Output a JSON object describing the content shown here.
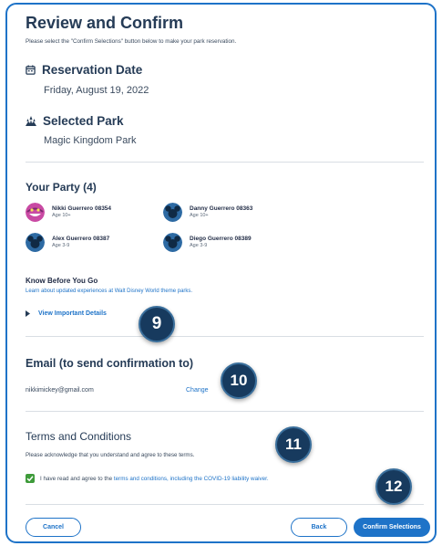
{
  "header": {
    "title": "Review and Confirm",
    "subtitle": "Please select the \"Confirm Selections\" button below to make your park reservation."
  },
  "reservation": {
    "date_label": "Reservation Date",
    "date_value": "Friday, August 19, 2022",
    "date_icon": "calendar-icon",
    "park_label": "Selected Park",
    "park_value": "Magic Kingdom Park",
    "park_icon": "castle-icon"
  },
  "party": {
    "title": "Your Party (4)",
    "members": [
      {
        "name": "Nikki Guerrero 08354",
        "age": "Age 10+",
        "avatar": "cheshire-cat-avatar"
      },
      {
        "name": "Danny Guerrero 08363",
        "age": "Age 10+",
        "avatar": "mickey-avatar"
      },
      {
        "name": "Alex Guerrero 08387",
        "age": "Age 3-9",
        "avatar": "mickey-avatar"
      },
      {
        "name": "Diego Guerrero 08389",
        "age": "Age 3-9",
        "avatar": "mickey-avatar"
      }
    ]
  },
  "know_before": {
    "title": "Know Before You Go",
    "link": "Learn about updated experiences at Walt Disney World theme parks.",
    "details_toggle": "View Important Details"
  },
  "email": {
    "title": "Email (to send confirmation to)",
    "value": "nikkimickey@gmail.com",
    "change": "Change"
  },
  "terms": {
    "title": "Terms and Conditions",
    "subtitle": "Please acknowledge that you understand and agree to these terms.",
    "check_prefix": "I have read and agree to the",
    "check_link": "terms and conditions, including the COVID-19 liability waiver.",
    "checked": true
  },
  "footer": {
    "cancel": "Cancel",
    "back": "Back",
    "confirm": "Confirm Selections"
  },
  "badges": {
    "step_9": "9",
    "step_10": "10",
    "step_11": "11",
    "step_12": "12"
  },
  "colors": {
    "accent": "#1e73c8",
    "heading": "#253b56",
    "check": "#3e9b3a",
    "badge": "#173a5e"
  }
}
